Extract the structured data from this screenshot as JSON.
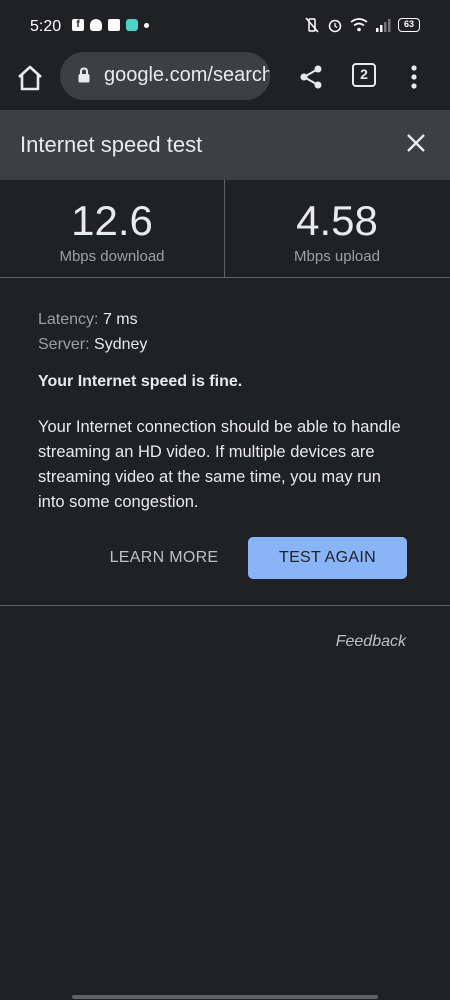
{
  "status_bar": {
    "time": "5:20",
    "notification_icons": [
      "facebook-icon",
      "snapchat-icon",
      "outlook-icon",
      "app-icon",
      "dot-icon"
    ],
    "system_icons": [
      "vibrate-icon",
      "alarm-icon",
      "wifi-icon",
      "signal-icon"
    ],
    "battery": "63"
  },
  "browser": {
    "url": "google.com/search",
    "tab_count": "2"
  },
  "card": {
    "title": "Internet speed test"
  },
  "speed": {
    "download_value": "12.6",
    "download_unit": "Mbps download",
    "upload_value": "4.58",
    "upload_unit": "Mbps upload"
  },
  "details": {
    "latency_label": "Latency:",
    "latency_value": "7 ms",
    "server_label": "Server:",
    "server_value": "Sydney"
  },
  "result": {
    "verdict": "Your Internet speed is fine.",
    "explanation": "Your Internet connection should be able to handle streaming an HD video. If multiple devices are streaming video at the same time, you may run into some congestion."
  },
  "actions": {
    "learn_more": "LEARN MORE",
    "test_again": "TEST AGAIN"
  },
  "footer": {
    "feedback": "Feedback"
  },
  "colors": {
    "background": "#202124",
    "header": "#3c4043",
    "accent": "#8ab4f8"
  }
}
